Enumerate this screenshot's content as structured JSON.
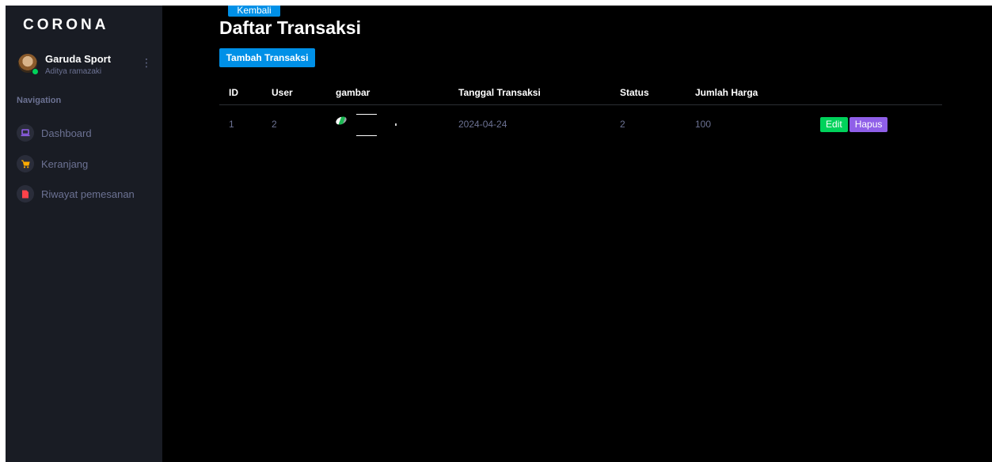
{
  "sidebar": {
    "brand": "CORONA",
    "profile": {
      "name": "Garuda Sport",
      "subtitle": "Aditya ramazaki",
      "menu_glyph": "⋮"
    },
    "nav_title": "Navigation",
    "items": [
      {
        "label": "Dashboard",
        "icon": "laptop-icon",
        "icon_color": "#8f5fe8"
      },
      {
        "label": "Keranjang",
        "icon": "cart-icon",
        "icon_color": "#ffab00"
      },
      {
        "label": "Riwayat pemesanan",
        "icon": "document-icon",
        "icon_color": "#fc424a"
      }
    ]
  },
  "main": {
    "back_label": "Kembali",
    "title": "Daftar Transaksi",
    "add_label": "Tambah Transaksi",
    "table": {
      "headers": [
        "ID",
        "User",
        "gambar",
        "Tanggal Transaksi",
        "Status",
        "Jumlah Harga"
      ],
      "rows": [
        {
          "id": "1",
          "user": "2",
          "tanggal": "2024-04-24",
          "status": "2",
          "jumlah": "100",
          "edit_label": "Edit",
          "delete_label": "Hapus"
        }
      ]
    }
  },
  "colors": {
    "sidebar_bg": "#191c24",
    "content_bg": "#000000",
    "primary": "#0090e7",
    "success": "#00d25b",
    "purple": "#8f5fe8",
    "muted_text": "#6c7293"
  }
}
